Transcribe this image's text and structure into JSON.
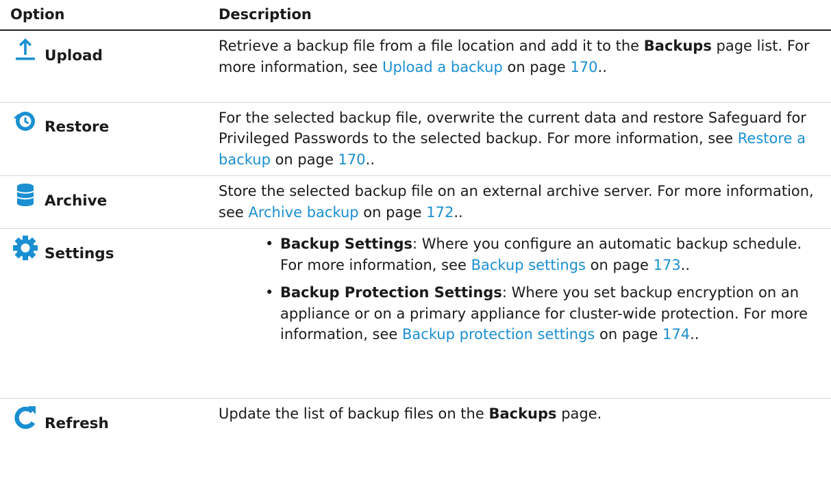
{
  "headers": {
    "option": "Option",
    "description": "Description"
  },
  "rows": [
    {
      "icon": "upload-icon",
      "label": "Upload",
      "desc": {
        "t1": "Retrieve a backup file from a file location and add it to the ",
        "b1": "Backups",
        "t2": " page list. For more information, see ",
        "link": "Upload a backup",
        "t3": " on page ",
        "page": "170",
        "t4": ".."
      }
    },
    {
      "icon": "restore-icon",
      "label": "Restore",
      "desc": {
        "t1": "For the selected backup file, overwrite the current data and restore Safeguard for Privileged Passwords to the selected backup. For more information, see ",
        "link": "Restore a backup",
        "t2": " on page ",
        "page": "170",
        "t3": ".."
      }
    },
    {
      "icon": "archive-icon",
      "label": "Archive",
      "desc": {
        "t1": "Store the selected backup file on an external archive server. For more information, see ",
        "link": "Archive backup",
        "t2": " on page ",
        "page": "172",
        "t3": ".."
      }
    },
    {
      "icon": "settings-icon",
      "label": "Settings",
      "bullets": [
        {
          "bullet": "•",
          "b1": "Backup Settings",
          "t1": ": Where you configure an automatic backup schedule. For more information, see ",
          "link": "Backup settings",
          "t2": " on page ",
          "page": "173",
          "t3": ".."
        },
        {
          "bullet": "•",
          "b1": "Backup Protection Settings",
          "t1": ": Where you set backup encryption on an appliance or on a primary appliance for cluster-wide protection. For more information, see ",
          "link": "Backup protection settings",
          "t2": " on page ",
          "page": "174",
          "t3": ".."
        }
      ]
    },
    {
      "icon": "refresh-icon",
      "label": "Refresh",
      "desc": {
        "t1": "Update the list of backup files on the ",
        "b1": "Backups",
        "t2": " page."
      }
    }
  ],
  "colors": {
    "link": "#1a8fd1",
    "icon": "#1a8fd1"
  }
}
